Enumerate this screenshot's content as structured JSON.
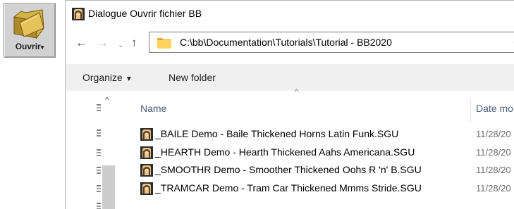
{
  "open_button": {
    "label": "Ouvrir",
    "icon": "folder-open-icon",
    "caret": "▾"
  },
  "dialog": {
    "title": "Dialogue Ouvrir fichier BB",
    "nav": {
      "back": "←",
      "forward": "→",
      "recent": "⌄",
      "up": "↑"
    },
    "address": {
      "path": "C:\\bb\\Documentation\\Tutorials\\Tutorial - BB2020",
      "dropdown": "⌄"
    },
    "commands": {
      "organize": "Organize",
      "organize_caret": "▼",
      "new_folder": "New folder"
    },
    "columns": {
      "sort_indicator": "^",
      "name": "Name",
      "date": "Date mo"
    },
    "tree_scroll_up": "^",
    "files": [
      {
        "name": "_BAILE Demo - Baile Thickened Horns Latin Funk.SGU",
        "date": "11/28/20"
      },
      {
        "name": "_HEARTH Demo - Hearth Thickened Aahs Americana.SGU",
        "date": "11/28/20"
      },
      {
        "name": "_SMOOTHR Demo - Smoother Thickened Oohs R 'n' B.SGU",
        "date": "11/28/20"
      },
      {
        "name": "_TRAMCAR Demo - Tram Car Thickened Mmms Stride.SGU",
        "date": "11/28/20"
      }
    ]
  },
  "colors": {
    "folder_yellow": "#ffd35c",
    "command_bar": "#f0f0f0",
    "column_header": "#4c607a"
  }
}
